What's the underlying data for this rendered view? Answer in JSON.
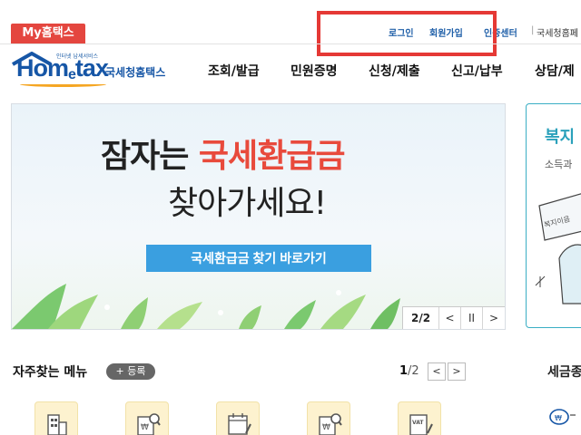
{
  "top": {
    "my_tab": "My홈택스",
    "login": "로그인",
    "signup": "회원가입",
    "cert_center": "인증센터",
    "other_site": "국세청홈페"
  },
  "logo": {
    "small_text": "인터넷 납세서비스",
    "main_text": "Hom",
    "e_text": "e",
    "tax_text": "tax",
    "ko_text": "국세청홈택스"
  },
  "gnb": [
    "조회/발급",
    "민원증명",
    "신청/제출",
    "신고/납부",
    "상담/제"
  ],
  "banner": {
    "line1_black": "잠자는 ",
    "line1_red": "국세환급금",
    "line2": "찾아가세요!",
    "button": "국세환급금 찾기 바로가기",
    "page_current": "2",
    "page_total": "/2",
    "prev": "<",
    "pause": "II",
    "next": ">"
  },
  "side_card": {
    "title": "복지",
    "subtitle": "소득과",
    "sign_text": "복지이음"
  },
  "favorites": {
    "title": "자주찾는 메뉴",
    "add_label": "+ 등록",
    "page_current": "1",
    "page_total": "/2",
    "prev": "<",
    "next": ">",
    "icons": [
      "building-doc-icon",
      "won-search-icon",
      "calendar-doc-icon",
      "won-search-icon",
      "vat-doc-icon"
    ],
    "vat_text": "VAT"
  },
  "side_section": {
    "title": "세금종"
  },
  "colors": {
    "brand_blue": "#1656a6",
    "accent_red": "#e84a3c",
    "button_blue": "#3a9fe0",
    "teal": "#2ba1bb",
    "highlight_red": "#e53935"
  }
}
